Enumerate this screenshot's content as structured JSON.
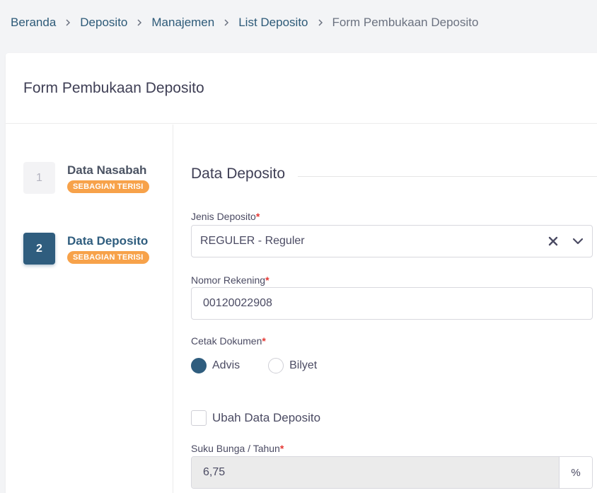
{
  "breadcrumb": {
    "items": [
      "Beranda",
      "Deposito",
      "Manajemen",
      "List Deposito"
    ],
    "current": "Form Pembukaan Deposito"
  },
  "page": {
    "title": "Form Pembukaan Deposito"
  },
  "stepper": {
    "steps": [
      {
        "number": "1",
        "label": "Data Nasabah",
        "status": "SEBAGIAN TERISI"
      },
      {
        "number": "2",
        "label": "Data Deposito",
        "status": "SEBAGIAN TERISI"
      }
    ]
  },
  "form": {
    "section_title": "Data Deposito",
    "jenis_deposito": {
      "label": "Jenis Deposito",
      "value": "REGULER - Reguler"
    },
    "nomor_rekening": {
      "label": "Nomor Rekening",
      "value": "00120022908"
    },
    "cetak_dokumen": {
      "label": "Cetak Dokumen",
      "options": [
        "Advis",
        "Bilyet"
      ],
      "selected": "Advis"
    },
    "ubah_data": {
      "label": "Ubah Data Deposito",
      "checked": false
    },
    "suku_bunga": {
      "label": "Suku Bunga / Tahun",
      "value": "6,75",
      "suffix": "%"
    },
    "required_mark": "*"
  },
  "colors": {
    "primary": "#2f5d7e",
    "badge": "#f7a24a",
    "required": "#e53935"
  }
}
